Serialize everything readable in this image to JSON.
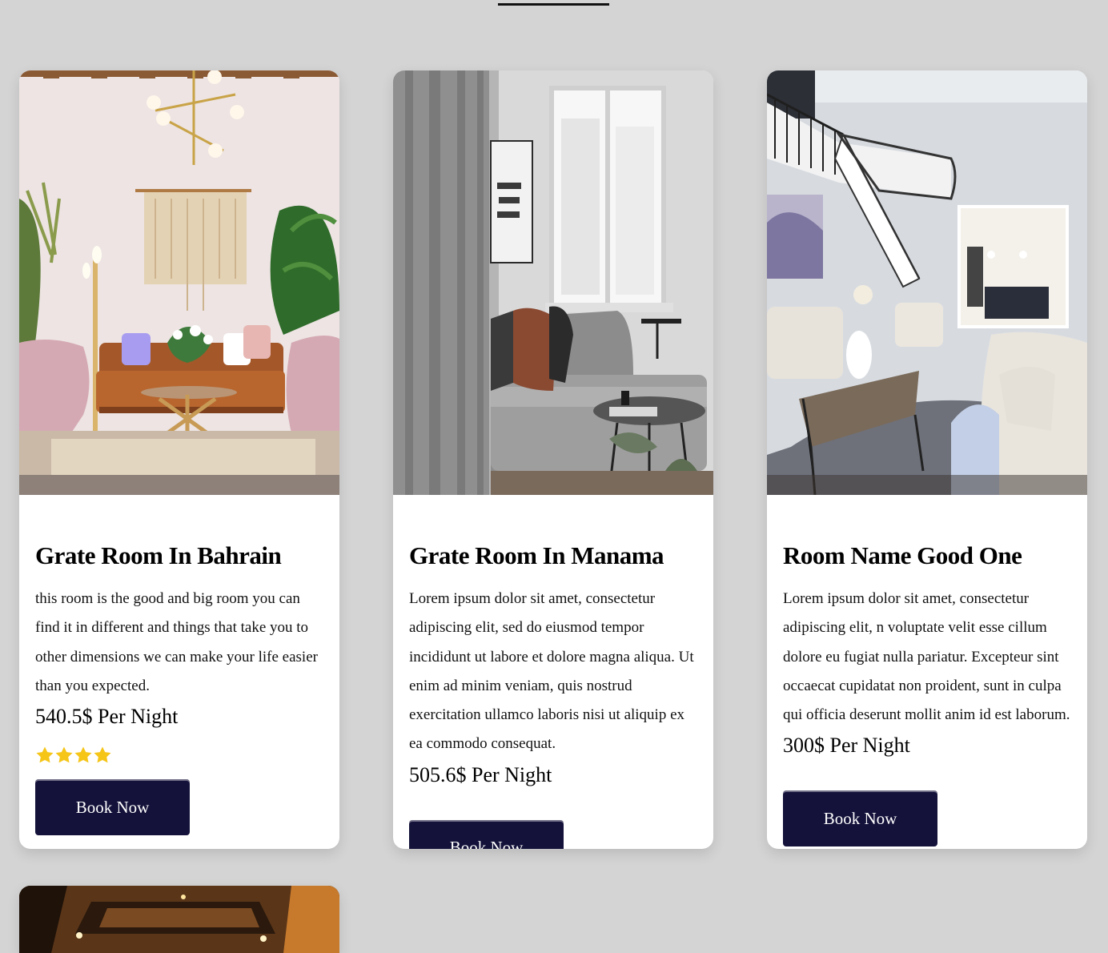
{
  "cards": [
    {
      "title": "Grate Room In Bahrain",
      "description": "this room is the good and big room you can find it in different and things that take you to other dimensions we can make your life easier than you expected.",
      "price": "540.5$ Per Night",
      "rating": 4,
      "button_label": "Book Now"
    },
    {
      "title": "Grate Room In Manama",
      "description": "Lorem ipsum dolor sit amet, consectetur adipiscing elit, sed do eiusmod tempor incididunt ut labore et dolore magna aliqua. Ut enim ad minim veniam, quis nostrud exercitation ullamco laboris nisi ut aliquip ex ea commodo consequat.",
      "price": "505.6$ Per Night",
      "button_label": "Book Now"
    },
    {
      "title": "Room Name Good One",
      "description": "Lorem ipsum dolor sit amet, consectetur adipiscing elit, n voluptate velit esse cillum dolore eu fugiat nulla pariatur. Excepteur sint occaecat cupidatat non proident, sunt in culpa qui officia deserunt mollit anim id est laborum.",
      "price": "300$ Per Night",
      "button_label": "Book Now"
    }
  ],
  "colors": {
    "page_background": "#d4d4d4",
    "button_background": "#14123a",
    "star": "#f5c518"
  },
  "icons": {
    "rating": "star-icon"
  }
}
